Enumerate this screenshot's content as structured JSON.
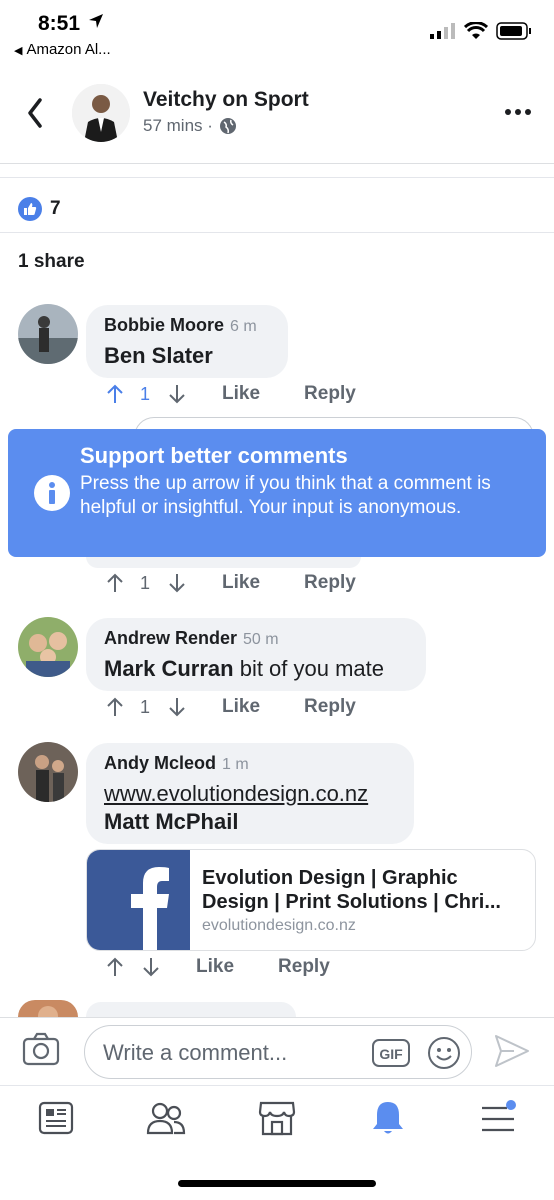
{
  "status_bar": {
    "time": "8:51",
    "back_app": "Amazon Al..."
  },
  "header": {
    "page_name": "Veitchy on Sport",
    "time": "57 mins ·"
  },
  "reactions": {
    "like_count": "7",
    "shares": "1 share"
  },
  "comments": [
    {
      "author": "Bobbie Moore",
      "time": "6 m",
      "text": "Ben Slater",
      "votes": "1",
      "like": "Like",
      "reply": "Reply"
    },
    {
      "votes": "1",
      "like": "Like",
      "reply": "Reply"
    },
    {
      "author": "Andrew Render",
      "time": "50 m",
      "mention": "Mark Curran",
      "text": " bit of you mate",
      "votes": "1",
      "like": "Like",
      "reply": "Reply"
    },
    {
      "author": "Andy Mcleod",
      "time": "1 m",
      "link": "www.evolutiondesign.co.nz",
      "mention": "Matt McPhail",
      "like": "Like",
      "reply": "Reply"
    }
  ],
  "tooltip": {
    "title": "Support better comments",
    "body": "Press the up arrow if you think that a comment is helpful or insightful. Your input is anonymous."
  },
  "link_preview": {
    "title": "Evolution Design | Graphic Design | Print Solutions | Chri...",
    "domain": "evolutiondesign.co.nz"
  },
  "compose": {
    "placeholder": "Write a comment...",
    "gif_label": "GIF"
  },
  "nav": {
    "items": [
      "news-feed",
      "friends",
      "marketplace",
      "notifications",
      "menu"
    ],
    "active": "notifications"
  },
  "colors": {
    "accent": "#5b8def",
    "facebook": "#3b5998",
    "like_blue": "#4a7fe8",
    "text_gray": "#606770"
  }
}
